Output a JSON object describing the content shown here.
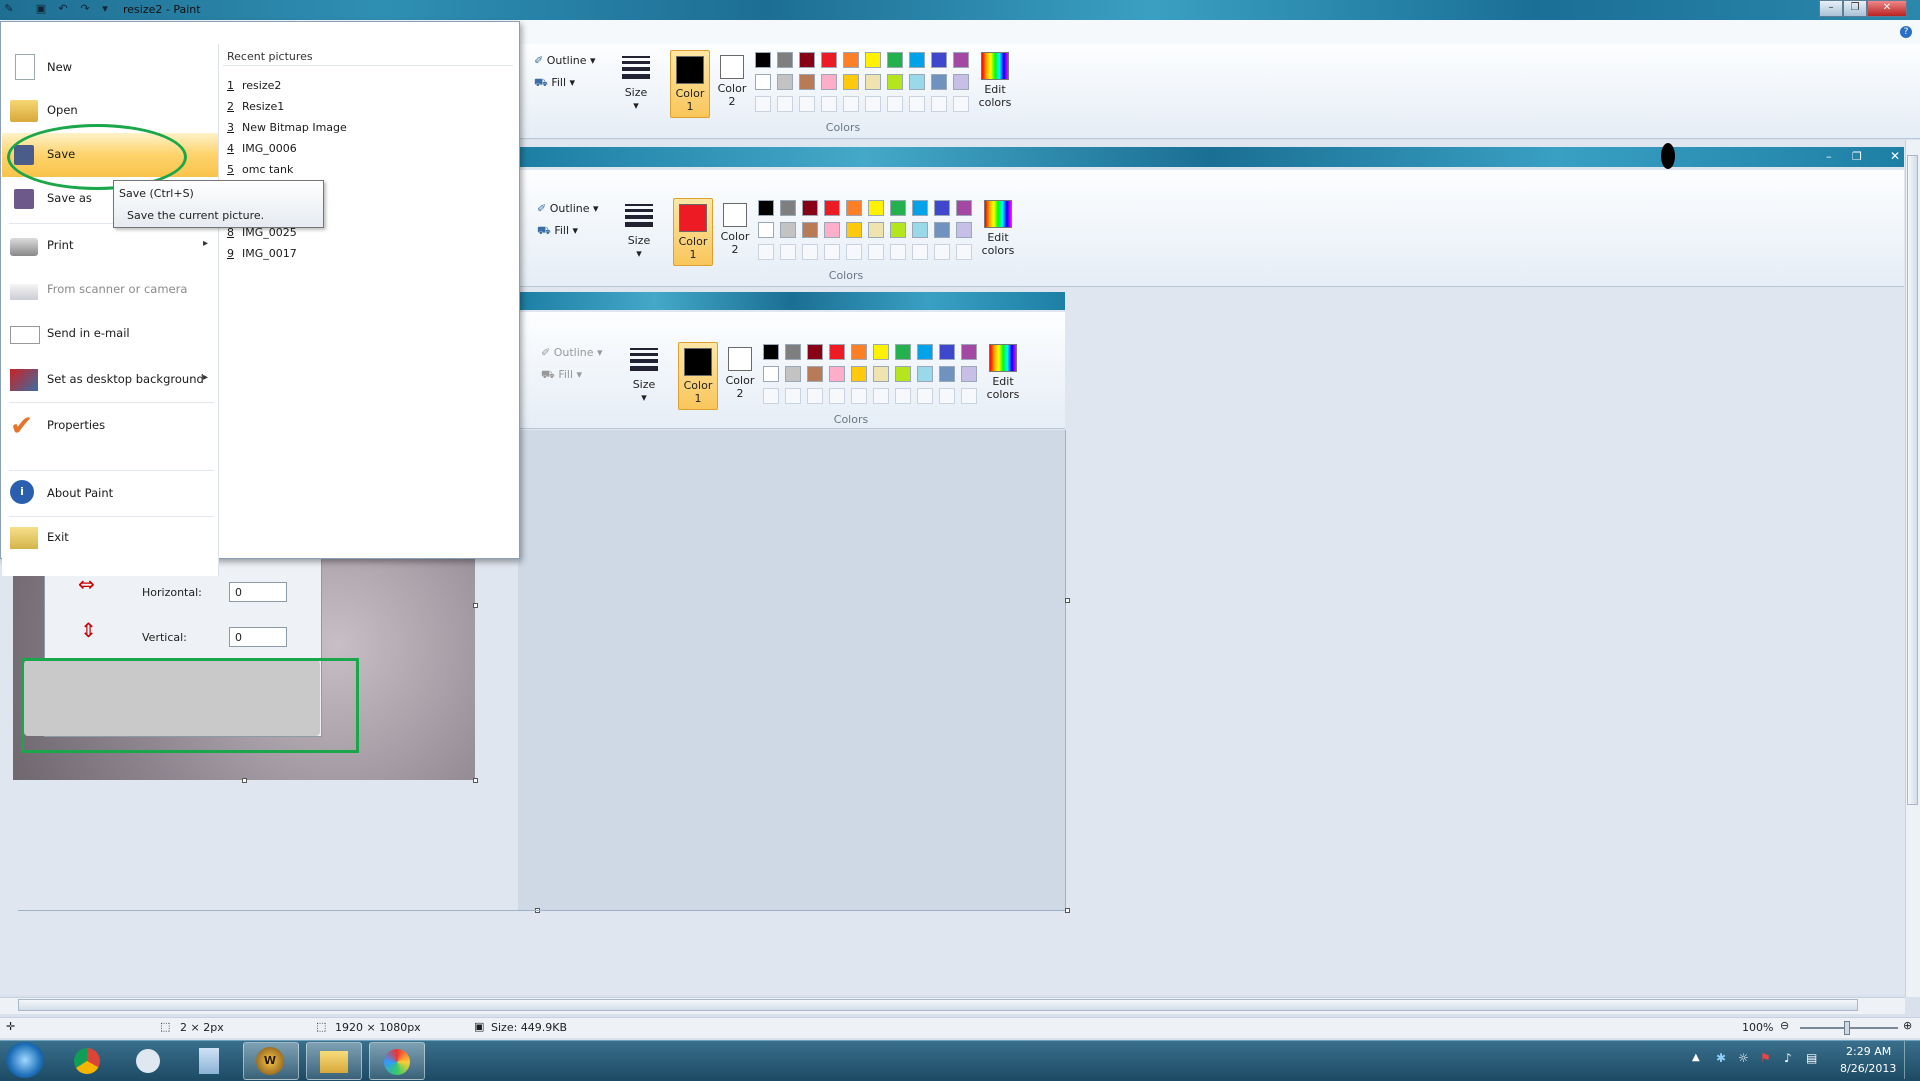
{
  "window": {
    "title": "resize2 - Paint",
    "controls": [
      "minimize",
      "restore",
      "close"
    ]
  },
  "file_menu": {
    "tab_icon": "file-menu-icon",
    "items": [
      {
        "label": "New",
        "icon": "new-document-icon"
      },
      {
        "label": "Open",
        "icon": "open-folder-icon"
      },
      {
        "label": "Save",
        "icon": "save-disk-icon"
      },
      {
        "label": "Save as",
        "icon": "save-as-icon"
      },
      {
        "label": "Print",
        "icon": "printer-icon"
      },
      {
        "label": "From scanner or camera",
        "icon": "scanner-icon"
      },
      {
        "label": "Send in e-mail",
        "icon": "email-icon"
      },
      {
        "label": "Set as desktop background",
        "icon": "desktop-background-icon"
      },
      {
        "label": "Properties",
        "icon": "checkmark-icon"
      },
      {
        "label": "About Paint",
        "icon": "info-icon"
      },
      {
        "label": "Exit",
        "icon": "exit-icon"
      }
    ],
    "recent_header": "Recent pictures",
    "recent": [
      {
        "num": "1",
        "name": "resize2"
      },
      {
        "num": "2",
        "name": "Resize1"
      },
      {
        "num": "3",
        "name": "New Bitmap Image"
      },
      {
        "num": "4",
        "name": "IMG_0006"
      },
      {
        "num": "5",
        "name": "omc tank"
      },
      {
        "num": "8",
        "name": "IMG_0025"
      },
      {
        "num": "9",
        "name": "IMG_0017"
      }
    ]
  },
  "tooltip": {
    "title": "Save (Ctrl+S)",
    "description": "Save the current picture."
  },
  "ribbon": {
    "outline_label": "Outline",
    "fill_label": "Fill",
    "size_label": "Size",
    "color1_label": "Color 1",
    "color1_line1": "Color",
    "color1_line2": "1",
    "color2_line1": "Color",
    "color2_line2": "2",
    "edit_colors_line1": "Edit",
    "edit_colors_line2": "colors",
    "colors_group_label": "Colors",
    "palette_row1": [
      "#000000",
      "#7f7f7f",
      "#880015",
      "#ed1c24",
      "#ff7f27",
      "#fff200",
      "#22b14c",
      "#00a2e8",
      "#3f48cc",
      "#a349a4"
    ],
    "palette_row2": [
      "#ffffff",
      "#c3c3c3",
      "#b97a57",
      "#ffaec9",
      "#ffc90e",
      "#efe4b0",
      "#b5e61d",
      "#99d9ea",
      "#7092be",
      "#c8bfe7"
    ],
    "color1_values": [
      "#000000",
      "#ed1c24",
      "#000000"
    ]
  },
  "skew_dialog": {
    "horizontal_label": "Horizontal:",
    "horizontal_value": "0",
    "vertical_label": "Vertical:",
    "vertical_value": "0"
  },
  "status_bar": {
    "selection": "2 × 2px",
    "image_size": "1920 × 1080px",
    "file_size": "Size: 449.9KB",
    "zoom": "100%"
  },
  "taskbar": {
    "apps": [
      "start-orb-icon",
      "chrome-icon",
      "messenger-icon",
      "notepad-icon",
      "wow-icon",
      "explorer-icon",
      "paint-icon"
    ],
    "time": "2:29 AM",
    "date": "8/26/2013"
  },
  "colors": {
    "highlight_orange": "#f9c34a",
    "annotation_green": "#1aa64a"
  }
}
